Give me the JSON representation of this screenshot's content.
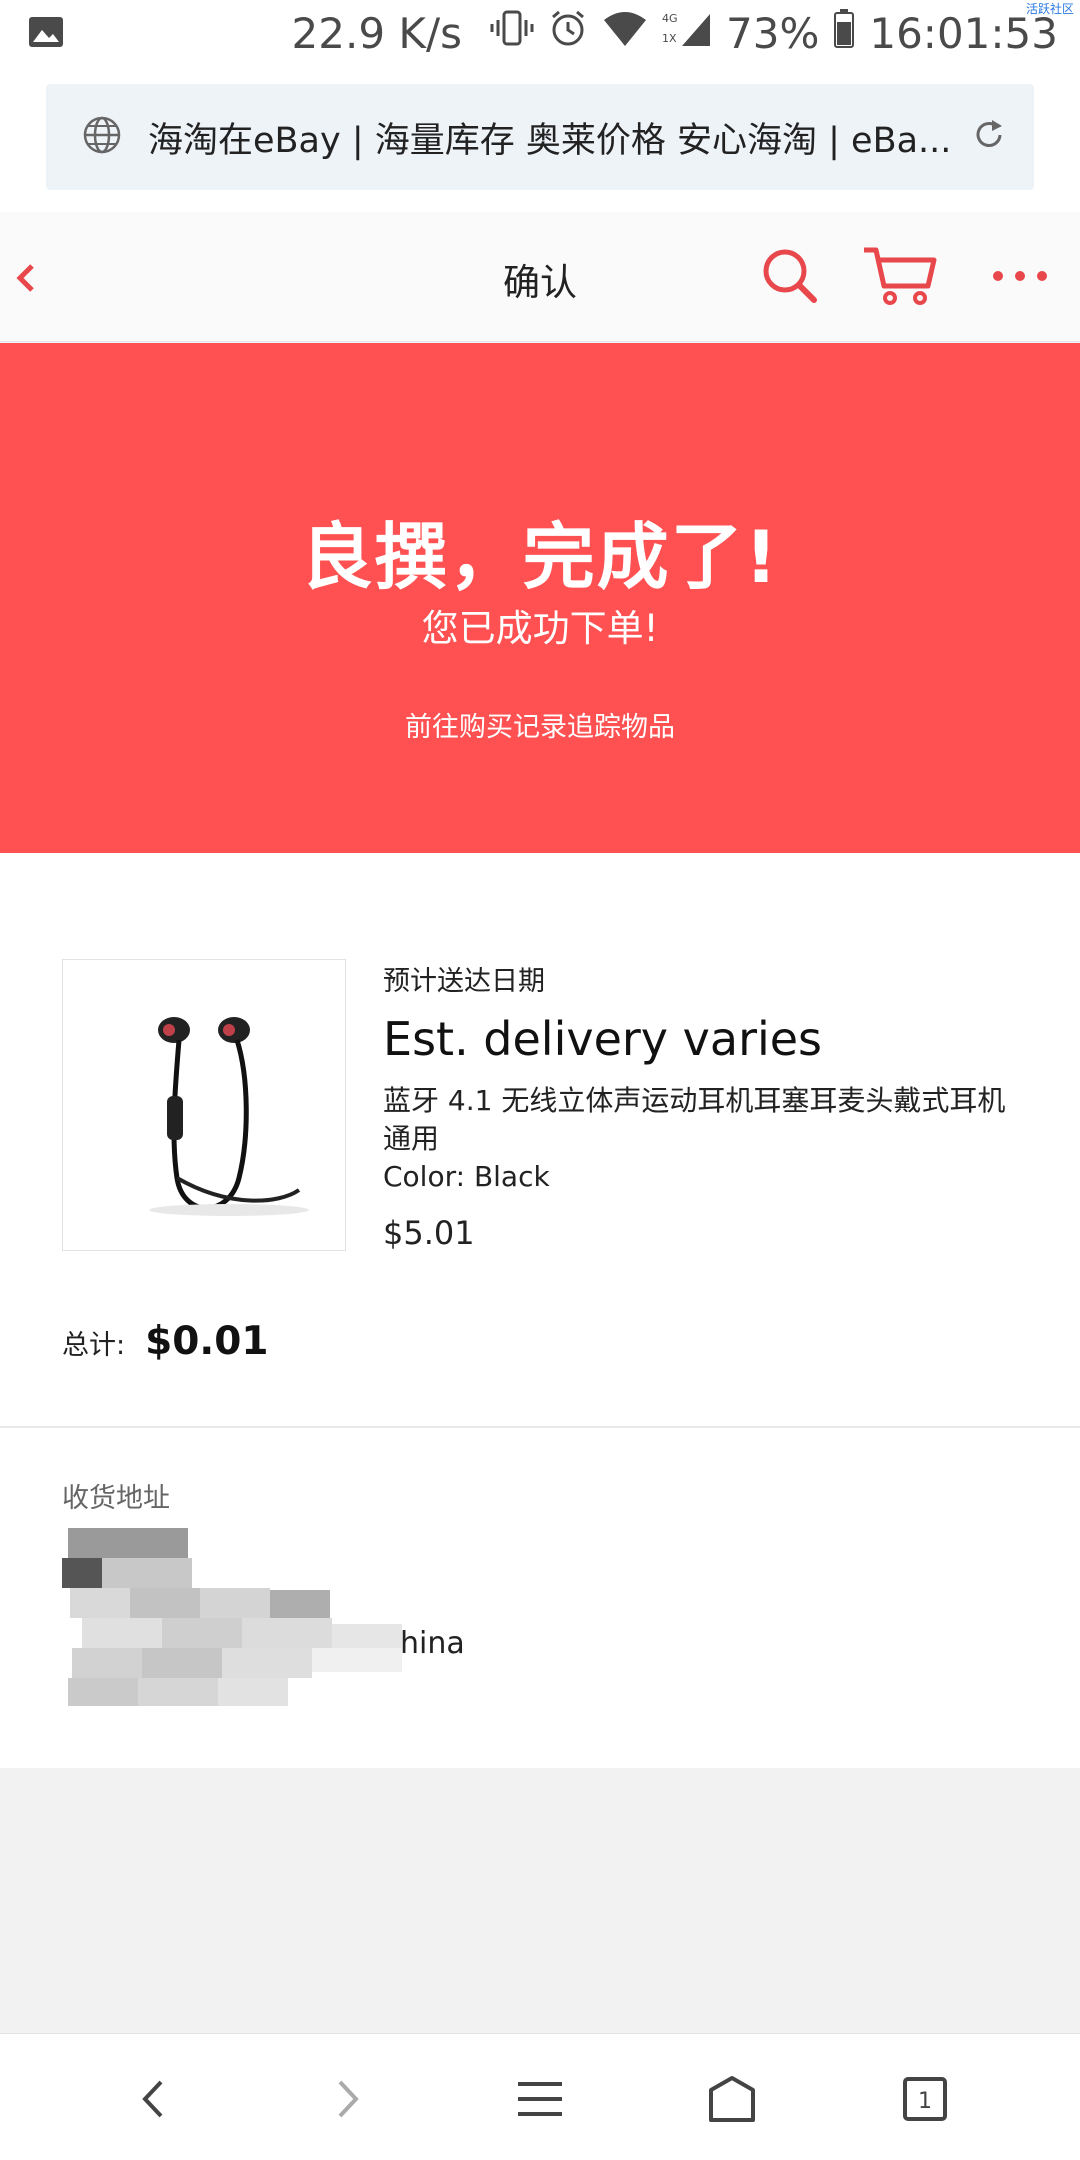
{
  "status_bar": {
    "speed": "22.9 K/s",
    "battery": "73%",
    "time": "16:01:53",
    "watermark": "活跃社区",
    "icons": [
      "image-icon",
      "vibrate-icon",
      "alarm-icon",
      "wifi-icon",
      "signal-icon",
      "battery-icon"
    ]
  },
  "browser": {
    "url_title": "海淘在eBay | 海量库存 奥莱价格 安心海淘 | eBa..."
  },
  "header": {
    "title": "确认"
  },
  "banner": {
    "headline": "良撰，完成了!",
    "subtitle": "您已成功下单!",
    "link": "前往购买记录追踪物品"
  },
  "order": {
    "delivery_label": "预计送达日期",
    "delivery_value": "Est. delivery varies",
    "item_name": "蓝牙 4.1 无线立体声运动耳机耳塞耳麦头戴式耳机通用",
    "item_color": "Color: Black",
    "item_price": "$5.01",
    "total_label": "总计:",
    "total_value": "$0.01"
  },
  "address": {
    "heading": "收货地址",
    "country_suffix": "hina"
  },
  "colors": {
    "brand_red": "#ff5052",
    "accent_red": "#e8474b"
  }
}
